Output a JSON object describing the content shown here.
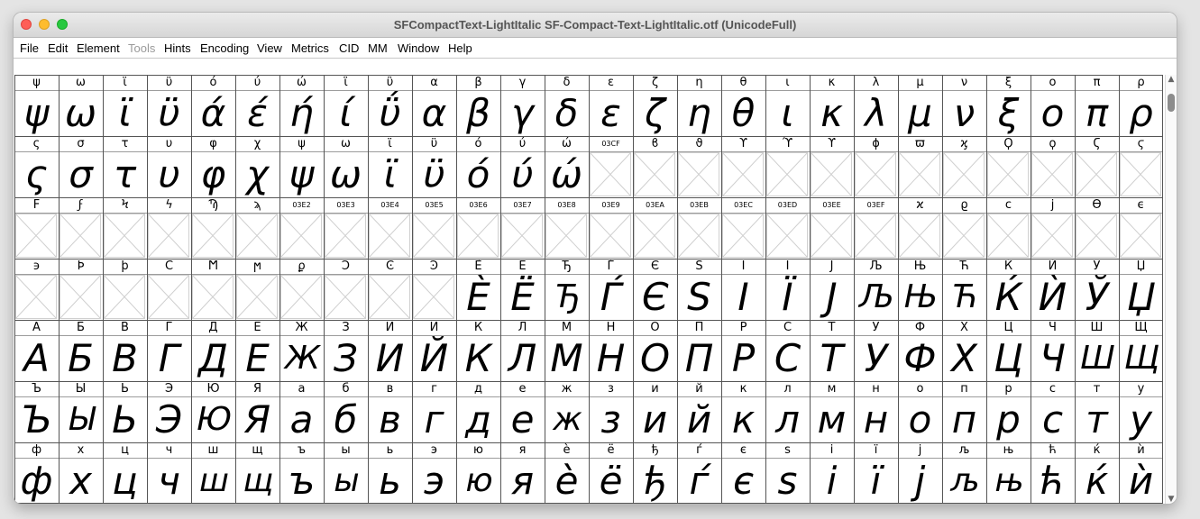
{
  "window": {
    "title": "SFCompactText-LightItalic  SF-Compact-Text-LightItalic.otf (UnicodeFull)"
  },
  "menu": [
    {
      "label": "File",
      "enabled": true
    },
    {
      "label": "Edit",
      "enabled": true
    },
    {
      "label": "Element",
      "enabled": true
    },
    {
      "label": "Tools",
      "enabled": false
    },
    {
      "label": "Hints",
      "enabled": true
    },
    {
      "label": "Encoding",
      "enabled": true
    },
    {
      "label": "View",
      "enabled": true
    },
    {
      "label": "Metrics",
      "enabled": true
    },
    {
      "label": "CID",
      "enabled": true
    },
    {
      "label": "MM",
      "enabled": true
    },
    {
      "label": "Window",
      "enabled": true
    },
    {
      "label": "Help",
      "enabled": true
    }
  ],
  "glyph_rows": [
    {
      "labels": [
        "ψ",
        "ω",
        "ϊ",
        "ϋ",
        "ό",
        "ύ",
        "ώ",
        "ΐ",
        "ΰ",
        "α",
        "β",
        "γ",
        "δ",
        "ε",
        "ζ",
        "η",
        "θ",
        "ι",
        "κ",
        "λ",
        "μ",
        "ν",
        "ξ",
        "ο",
        "π",
        "ρ"
      ],
      "glyphs": [
        "ψ",
        "ω",
        "ϊ",
        "ϋ",
        "ά",
        "έ",
        "ή",
        "ί",
        "ΰ",
        "α",
        "β",
        "γ",
        "δ",
        "ε",
        "ζ",
        "η",
        "θ",
        "ι",
        "κ",
        "λ",
        "μ",
        "ν",
        "ξ",
        "ο",
        "π",
        "ρ"
      ]
    },
    {
      "labels": [
        "ς",
        "σ",
        "τ",
        "υ",
        "φ",
        "χ",
        "ψ",
        "ω",
        "ϊ",
        "ϋ",
        "ό",
        "ύ",
        "ώ",
        "03CF",
        "ϐ",
        "ϑ",
        "ϒ",
        "ϓ",
        "ϔ",
        "ϕ",
        "ϖ",
        "ϗ",
        "Ϙ",
        "ϙ",
        "Ϛ",
        "ϛ"
      ],
      "glyphs": [
        "ς",
        "σ",
        "τ",
        "υ",
        "φ",
        "χ",
        "ψ",
        "ω",
        "ϊ",
        "ϋ",
        "ό",
        "ύ",
        "ώ",
        "",
        "",
        "",
        "",
        "",
        "",
        "",
        "",
        "",
        "",
        "",
        "",
        ""
      ]
    },
    {
      "labels": [
        "Ϝ",
        "ϝ",
        "Ϟ",
        "ϟ",
        "Ϡ",
        "ϡ",
        "03E2",
        "03E3",
        "03E4",
        "03E5",
        "03E6",
        "03E7",
        "03E8",
        "03E9",
        "03EA",
        "03EB",
        "03EC",
        "03ED",
        "03EE",
        "03EF",
        "ϰ",
        "ϱ",
        "ϲ",
        "ϳ",
        "ϴ",
        "ϵ"
      ],
      "glyphs": [
        "",
        "",
        "",
        "",
        "",
        "",
        "",
        "",
        "",
        "",
        "",
        "",
        "",
        "",
        "",
        "",
        "",
        "",
        "",
        "",
        "",
        "",
        "",
        "",
        "",
        ""
      ]
    },
    {
      "labels": [
        "϶",
        "Ϸ",
        "ϸ",
        "Ϲ",
        "Ϻ",
        "ϻ",
        "ϼ",
        "Ͻ",
        "Ͼ",
        "Ͽ",
        "Ѐ",
        "Ё",
        "Ђ",
        "Ѓ",
        "Є",
        "Ѕ",
        "І",
        "Ї",
        "Ј",
        "Љ",
        "Њ",
        "Ћ",
        "Ќ",
        "Ѝ",
        "Ў",
        "Џ"
      ],
      "glyphs": [
        "",
        "",
        "",
        "",
        "",
        "",
        "",
        "",
        "",
        "",
        "È",
        "Ë",
        "Ђ",
        "Ѓ",
        "Є",
        "S",
        "I",
        "Ï",
        "J",
        "Љ",
        "Њ",
        "Ћ",
        "Ќ",
        "Ѝ",
        "Ў",
        "Џ"
      ]
    },
    {
      "labels": [
        "А",
        "Б",
        "В",
        "Г",
        "Д",
        "Е",
        "Ж",
        "З",
        "И",
        "Й",
        "К",
        "Л",
        "М",
        "Н",
        "О",
        "П",
        "Р",
        "С",
        "Т",
        "У",
        "Ф",
        "Х",
        "Ц",
        "Ч",
        "Ш",
        "Щ"
      ],
      "glyphs": [
        "А",
        "Б",
        "В",
        "Г",
        "Д",
        "Е",
        "Ж",
        "З",
        "И",
        "Й",
        "К",
        "Л",
        "М",
        "Н",
        "О",
        "П",
        "Р",
        "С",
        "Т",
        "У",
        "Ф",
        "Х",
        "Ц",
        "Ч",
        "Ш",
        "Щ"
      ]
    },
    {
      "labels": [
        "Ъ",
        "Ы",
        "Ь",
        "Э",
        "Ю",
        "Я",
        "а",
        "б",
        "в",
        "г",
        "д",
        "е",
        "ж",
        "з",
        "и",
        "й",
        "к",
        "л",
        "м",
        "н",
        "о",
        "п",
        "р",
        "с",
        "т",
        "у"
      ],
      "glyphs": [
        "Ъ",
        "Ы",
        "Ь",
        "Э",
        "Ю",
        "Я",
        "а",
        "б",
        "в",
        "г",
        "д",
        "е",
        "ж",
        "з",
        "и",
        "й",
        "к",
        "л",
        "м",
        "н",
        "о",
        "п",
        "р",
        "с",
        "т",
        "у"
      ]
    },
    {
      "labels": [
        "ф",
        "х",
        "ц",
        "ч",
        "ш",
        "щ",
        "ъ",
        "ы",
        "ь",
        "э",
        "ю",
        "я",
        "è",
        "ё",
        "ђ",
        "ѓ",
        "є",
        "s",
        "і",
        "ï",
        "j",
        "љ",
        "њ",
        "ћ",
        "ќ",
        "ѝ"
      ],
      "glyphs": [
        "ф",
        "х",
        "ц",
        "ч",
        "ш",
        "щ",
        "ъ",
        "ы",
        "ь",
        "э",
        "ю",
        "я",
        "è",
        "ё",
        "ђ",
        "ѓ",
        "є",
        "s",
        "і",
        "ï",
        "j",
        "љ",
        "њ",
        "ћ",
        "ќ",
        "ѝ"
      ]
    }
  ],
  "scrollbar": {
    "position": 0.02
  }
}
